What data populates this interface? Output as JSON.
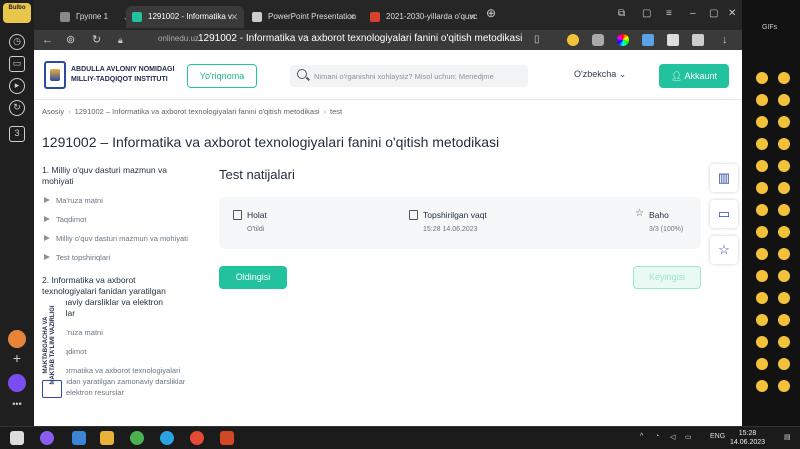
{
  "sidepanel": {
    "badge": "Bulbo"
  },
  "browser": {
    "tabs": [
      {
        "label": "Группе 1",
        "active": false
      },
      {
        "label": "1291002 - Informatika v",
        "active": true
      },
      {
        "label": "PowerPoint Presentation",
        "active": false
      },
      {
        "label": "2021-2030-yillarda o'quvc",
        "active": false
      }
    ],
    "url_domain": "onlinedu.uz",
    "url_title": "1291002 - Informatika va axborot texnologiyalari fanini o'qitish metodikasi"
  },
  "header": {
    "logo_line1": "ABDULLA AVLONIY NOMIDAGI",
    "logo_line2": "MILLIY-TADQIQOT INSTITUTI",
    "guide_label": "Yo'riqnoma",
    "search_placeholder": "Nimani o'rganishni xohlaysiz? Misol uchun: Menedjme",
    "language": "O'zbekcha",
    "account_label": "Akkaunt"
  },
  "breadcrumb": {
    "home": "Asosiy",
    "course": "1291002 – Informatika va axborot texnologiyalari fanini o'qitish metodikasi",
    "current": "test"
  },
  "page_title": "1291002 – Informatika va axborot texnologiyalari fanini o'qitish metodikasi",
  "course_sidebar": {
    "section1_title": "1. Milliy o'quv dasturi mazmun va mohiyati",
    "section1_lessons": [
      "Ma'ruza matni",
      "Taqdimot",
      "Milliy o'quv dasturi mazmun va mohiyati",
      "Test topshiriqlari"
    ],
    "section2_title": "2. Informatika va axborot texnologiyalari fanidan yaratilgan zamonaviy darsliklar va elektron resurslar",
    "section2_lessons": [
      "Ma'ruza matni",
      "Taqdimot",
      "Informatika va axborot texnologiyalari fanidan yaratilgan zamonaviy darsliklar va elektron resurslar"
    ]
  },
  "results": {
    "title": "Test natijalari",
    "status_label": "Holat",
    "status_value": "O'tildi",
    "submitted_label": "Topshirilgan vaqt",
    "submitted_value": "15:28 14.06.2023",
    "grade_label": "Baho",
    "grade_value": "3/3 (100%)",
    "prev_label": "Oldingisi",
    "next_label": "Keyingisi"
  },
  "ministry": {
    "text": "MAKTABGACHA VA MAKTAB TA'LIMI VAZIRLIGI"
  },
  "emoji_panel": {
    "title": "GIFs"
  },
  "taskbar": {
    "language": "ENG",
    "time": "15:28",
    "date": "14.06.2023"
  },
  "colors": {
    "accent": "#21c29d",
    "brand": "#2b4aa0"
  }
}
